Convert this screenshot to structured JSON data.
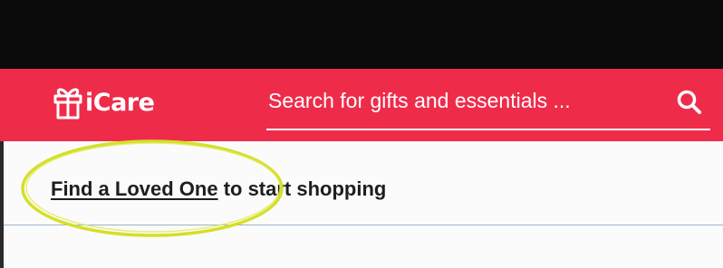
{
  "header": {
    "brand": "iCare",
    "search": {
      "placeholder": "Search for gifts and essentials ..."
    }
  },
  "main": {
    "find_link_label": "Find a Loved One",
    "prompt_suffix": " to start shopping"
  },
  "colors": {
    "brand_red": "#ef2b4a",
    "top_bar": "#0b0b0b",
    "highlight_ring": "#d4e02a"
  },
  "icons": {
    "logo": "gift-icon",
    "search": "search-icon"
  }
}
